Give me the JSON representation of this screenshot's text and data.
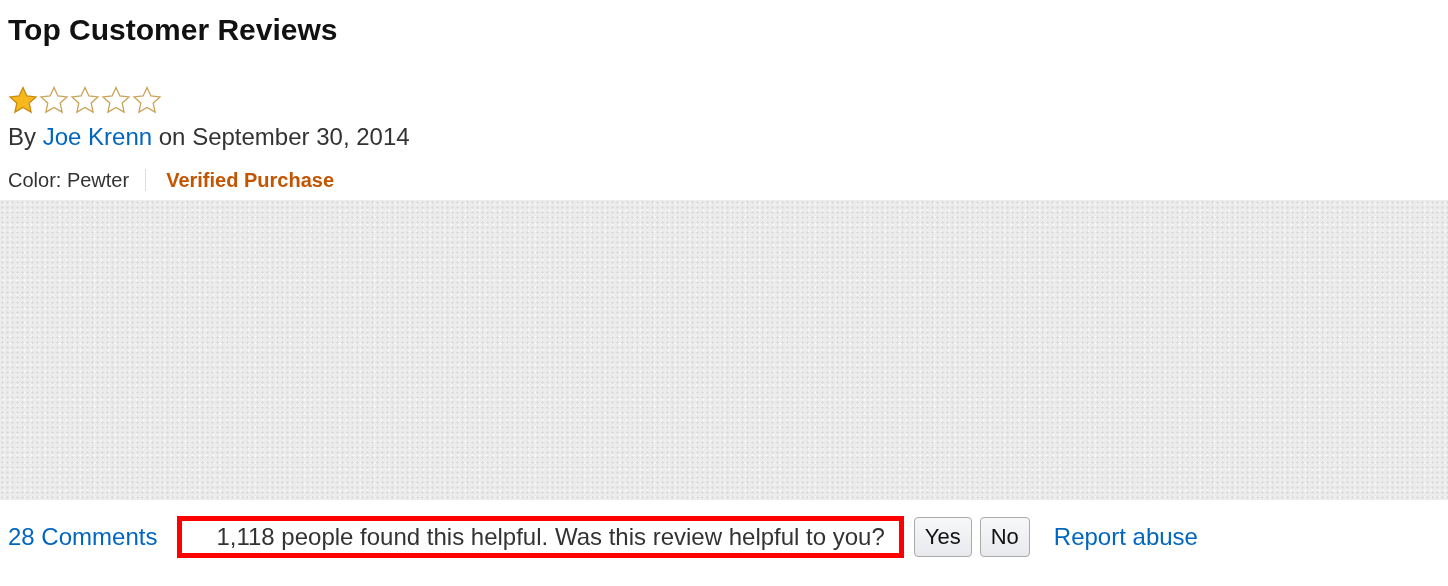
{
  "heading": "Top Customer Reviews",
  "review": {
    "stars": 1,
    "by": "By",
    "author": "Joe Krenn",
    "date": "on September 30, 2014",
    "variant": "Color: Pewter",
    "badge": "Verified Purchase",
    "body": {
      "kind": "redacted"
    }
  },
  "footer": {
    "comments": "28 Comments",
    "helpful": "1,118 people found this helpful. Was this review helpful to you?",
    "highlighted": true,
    "buttons": [
      "Yes",
      "No"
    ],
    "report": "Report abuse"
  }
}
